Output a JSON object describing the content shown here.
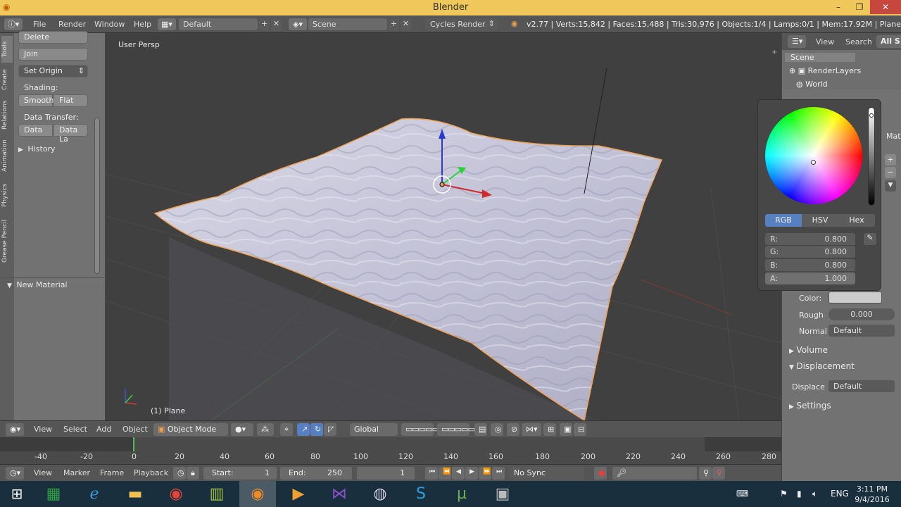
{
  "window": {
    "title": "Blender"
  },
  "menubar": {
    "items": [
      "File",
      "Render",
      "Window",
      "Help"
    ],
    "layout": "Default",
    "scene": "Scene",
    "engine": "Cycles Render",
    "stats": "v2.77 | Verts:15,842 | Faces:15,488 | Tris:30,976 | Objects:1/4 | Lamps:0/1 | Mem:17.92M | Plane"
  },
  "toolshelf": {
    "tabs": [
      "Tools",
      "Create",
      "Relations",
      "Animation",
      "Physics",
      "Grease Pencil"
    ],
    "delete": "Delete",
    "join": "Join",
    "set_origin": "Set Origin",
    "shading_label": "Shading:",
    "smooth": "Smooth",
    "flat": "Flat",
    "data_transfer_label": "Data Transfer:",
    "data": "Data",
    "data_layout": "Data La",
    "history": "History",
    "new_material": "New Material"
  },
  "viewport": {
    "view_name": "User Persp",
    "object_name": "(1) Plane"
  },
  "view_header": {
    "view": "View",
    "select": "Select",
    "add": "Add",
    "object": "Object",
    "mode": "Object Mode",
    "orientation": "Global"
  },
  "timeline": {
    "ticks": [
      "-40",
      "-20",
      "0",
      "20",
      "40",
      "60",
      "80",
      "100",
      "120",
      "140",
      "160",
      "180",
      "200",
      "220",
      "240",
      "260",
      "280"
    ]
  },
  "timeline_header": {
    "view": "View",
    "marker": "Marker",
    "frame": "Frame",
    "playback": "Playback",
    "start_label": "Start:",
    "start": "1",
    "end_label": "End:",
    "end": "250",
    "current": "1",
    "sync": "No Sync"
  },
  "outliner": {
    "view": "View",
    "search": "Search",
    "all_scenes": "All S",
    "items": [
      "Scene",
      "RenderLayers",
      "World"
    ]
  },
  "color_picker": {
    "tabs": [
      "RGB",
      "HSV",
      "Hex"
    ],
    "r_label": "R:",
    "r": "0.800",
    "g_label": "G:",
    "g": "0.800",
    "b_label": "B:",
    "b": "0.800",
    "a_label": "A:",
    "a": "1.000"
  },
  "properties": {
    "color_label": "Color:",
    "rough_label": "Rough",
    "rough": "0.000",
    "normal_label": "Normal",
    "normal": "Default",
    "volume": "Volume",
    "displacement": "Displacement",
    "displace_label": "Displace",
    "displace": "Default",
    "settings": "Settings",
    "mat_fragment": "Mat"
  },
  "taskbar": {
    "lang": "ENG",
    "time": "3:11 PM",
    "date": "9/4/2016"
  },
  "colors": {
    "title_bar": "#f0c75a",
    "accent": "#5680c2",
    "mesh": "#c9c9dc",
    "selection": "#f0a050"
  }
}
